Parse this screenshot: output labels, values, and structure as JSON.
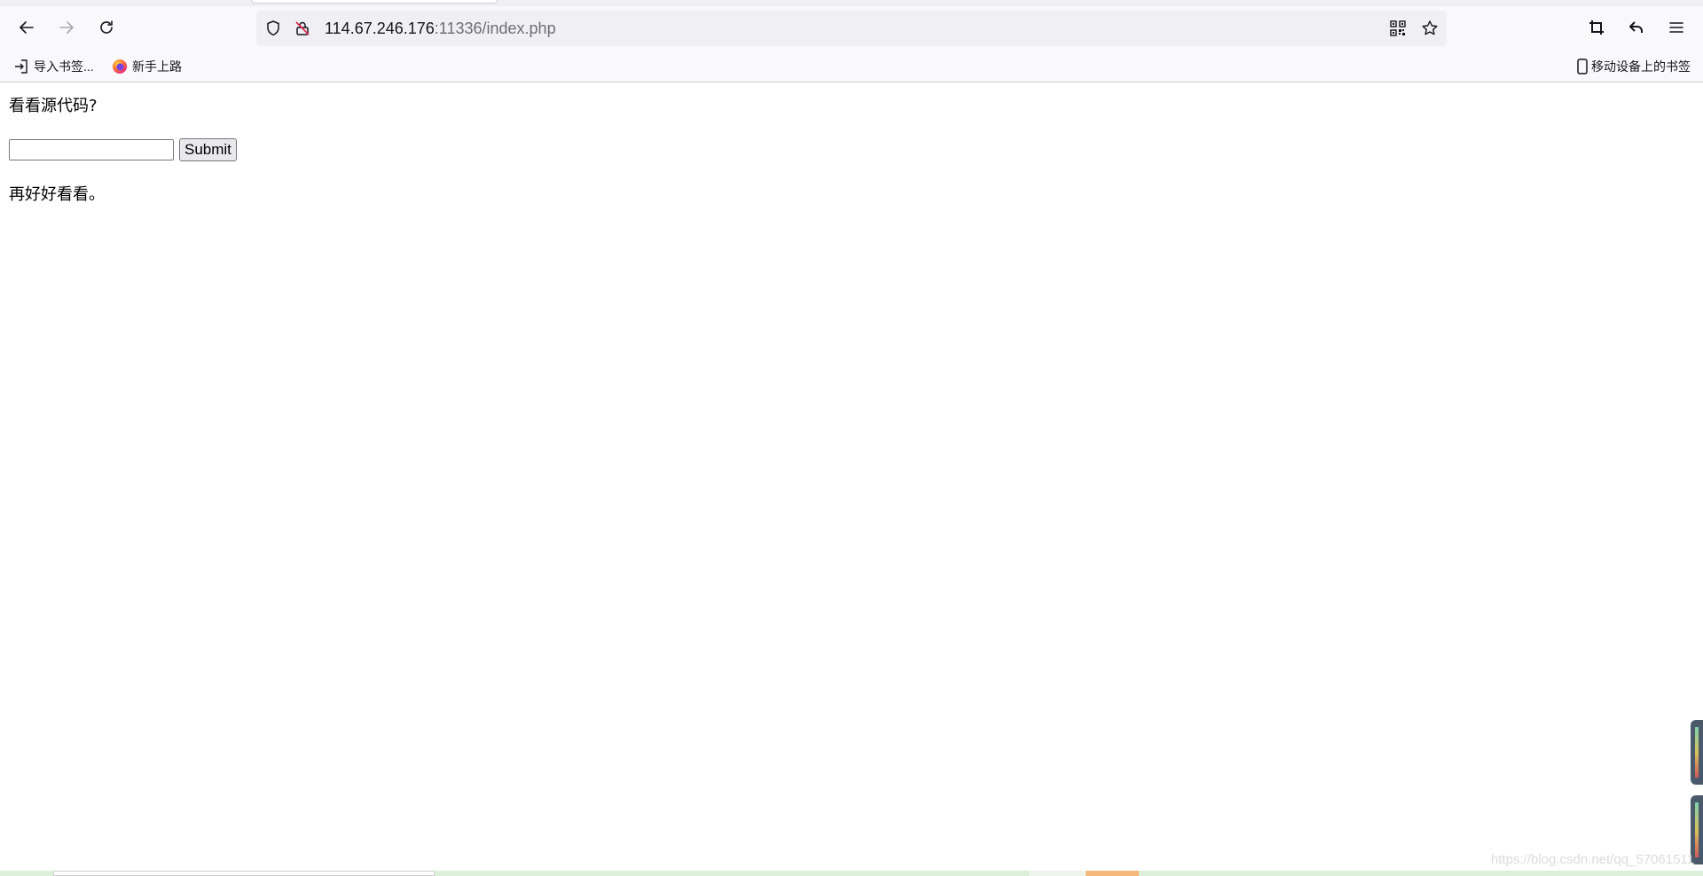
{
  "browser": {
    "url": {
      "host": "114.67.246.176",
      "rest": ":11336/index.php"
    },
    "bookmarks": [
      {
        "label": "导入书签...",
        "icon": "import-icon"
      },
      {
        "label": "新手上路",
        "icon": "firefox-icon"
      }
    ],
    "mobile_bookmarks": {
      "label": "移动设备上的书签",
      "icon": "mobile-device-icon"
    },
    "icons": [
      "back-icon",
      "forward-icon",
      "reload-icon",
      "shield-icon",
      "insecure-lock-icon",
      "qr-code-icon",
      "star-icon",
      "screenshot-crop-icon",
      "undo-icon",
      "menu-icon"
    ]
  },
  "page": {
    "heading": "看看源代码?",
    "input": {
      "value": "",
      "placeholder": ""
    },
    "submit_label": "Submit",
    "result_text": "再好好看看。"
  },
  "watermark": "https://blog.csdn.net/qq_57061511",
  "colors": {
    "toolbar_bg": "#f9f9fb",
    "urlbar_bg": "#f0f0f4",
    "text": "#15141a",
    "dim_text": "#6d6d75"
  }
}
